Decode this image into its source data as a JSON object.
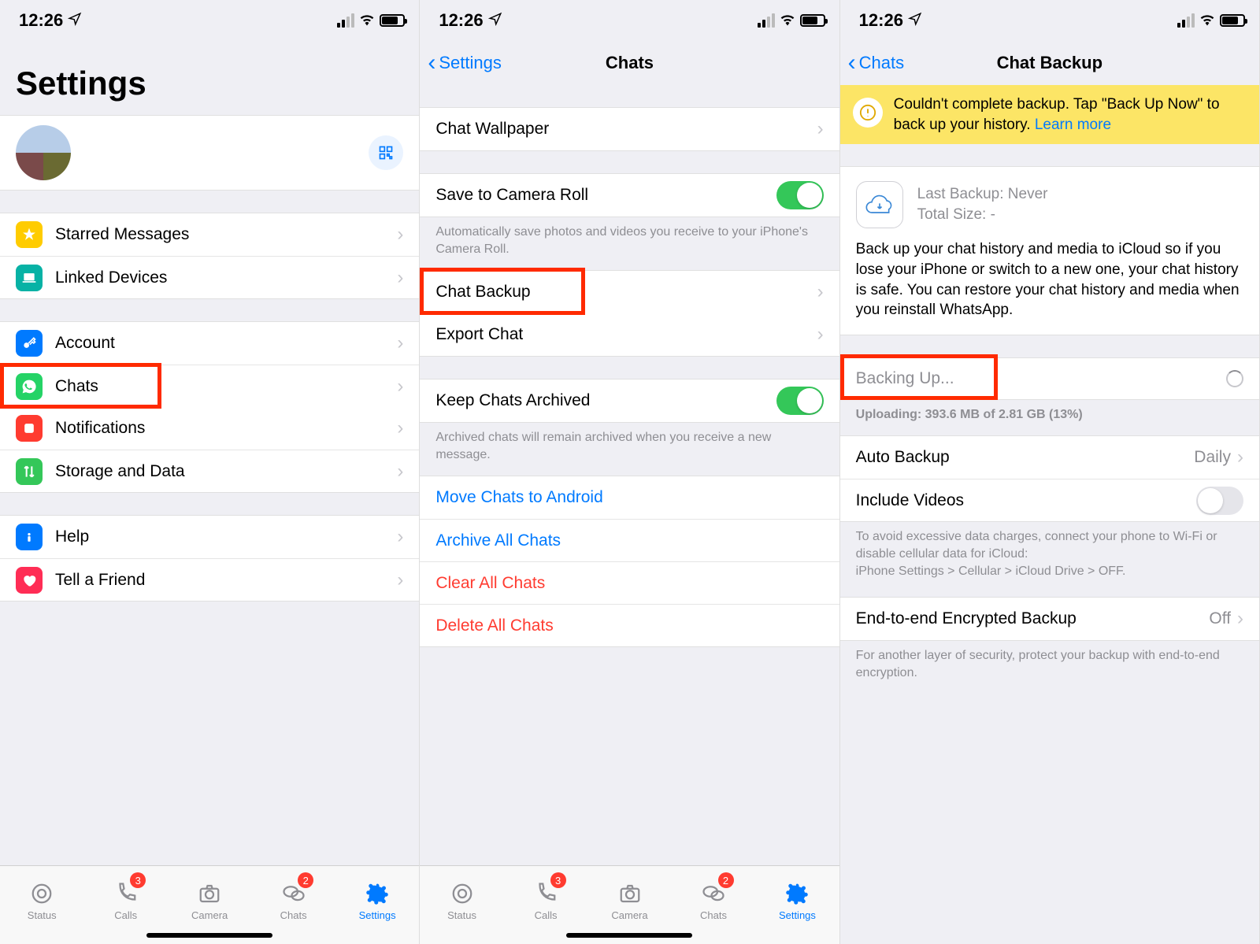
{
  "status": {
    "time": "12:26"
  },
  "screen1": {
    "title": "Settings",
    "items_group1": [
      {
        "label": "Starred Messages",
        "icon": "star",
        "color": "#ffcc00"
      },
      {
        "label": "Linked Devices",
        "icon": "laptop",
        "color": "#07b2a5"
      }
    ],
    "items_group2": [
      {
        "label": "Account",
        "icon": "key",
        "color": "#007aff"
      },
      {
        "label": "Chats",
        "icon": "whatsapp",
        "color": "#25d366"
      },
      {
        "label": "Notifications",
        "icon": "bell",
        "color": "#ff3b30"
      },
      {
        "label": "Storage and Data",
        "icon": "arrows",
        "color": "#34c759"
      }
    ],
    "items_group3": [
      {
        "label": "Help",
        "icon": "info",
        "color": "#007aff"
      },
      {
        "label": "Tell a Friend",
        "icon": "heart",
        "color": "#ff2d55"
      }
    ]
  },
  "screen2": {
    "back": "Settings",
    "title": "Chats",
    "wallpaper": "Chat Wallpaper",
    "save_camera": "Save to Camera Roll",
    "save_camera_footer": "Automatically save photos and videos you receive to your iPhone's Camera Roll.",
    "chat_backup": "Chat Backup",
    "export_chat": "Export Chat",
    "keep_archived": "Keep Chats Archived",
    "keep_archived_footer": "Archived chats will remain archived when you receive a new message.",
    "move_android": "Move Chats to Android",
    "archive_all": "Archive All Chats",
    "clear_all": "Clear All Chats",
    "delete_all": "Delete All Chats"
  },
  "screen3": {
    "back": "Chats",
    "title": "Chat Backup",
    "banner_text": "Couldn't complete backup. Tap \"Back Up Now\" to back up your history.",
    "banner_learn": "Learn more",
    "last_backup_label": "Last Backup: Never",
    "total_size_label": "Total Size: -",
    "desc": "Back up your chat history and media to iCloud so if you lose your iPhone or switch to a new one, your chat history is safe. You can restore your chat history and media when you reinstall WhatsApp.",
    "backing_up": "Backing Up...",
    "uploading": "Uploading: 393.6 MB of 2.81 GB (13%)",
    "auto_backup": "Auto Backup",
    "auto_backup_value": "Daily",
    "include_videos": "Include Videos",
    "include_footer": "To avoid excessive data charges, connect your phone to Wi-Fi or disable cellular data for iCloud:\niPhone Settings > Cellular > iCloud Drive > OFF.",
    "e2e": "End-to-end Encrypted Backup",
    "e2e_value": "Off",
    "e2e_footer": "For another layer of security, protect your backup with end-to-end encryption."
  },
  "tabs": {
    "status": "Status",
    "calls": "Calls",
    "calls_badge": "3",
    "camera": "Camera",
    "chats": "Chats",
    "chats_badge": "2",
    "settings": "Settings"
  }
}
